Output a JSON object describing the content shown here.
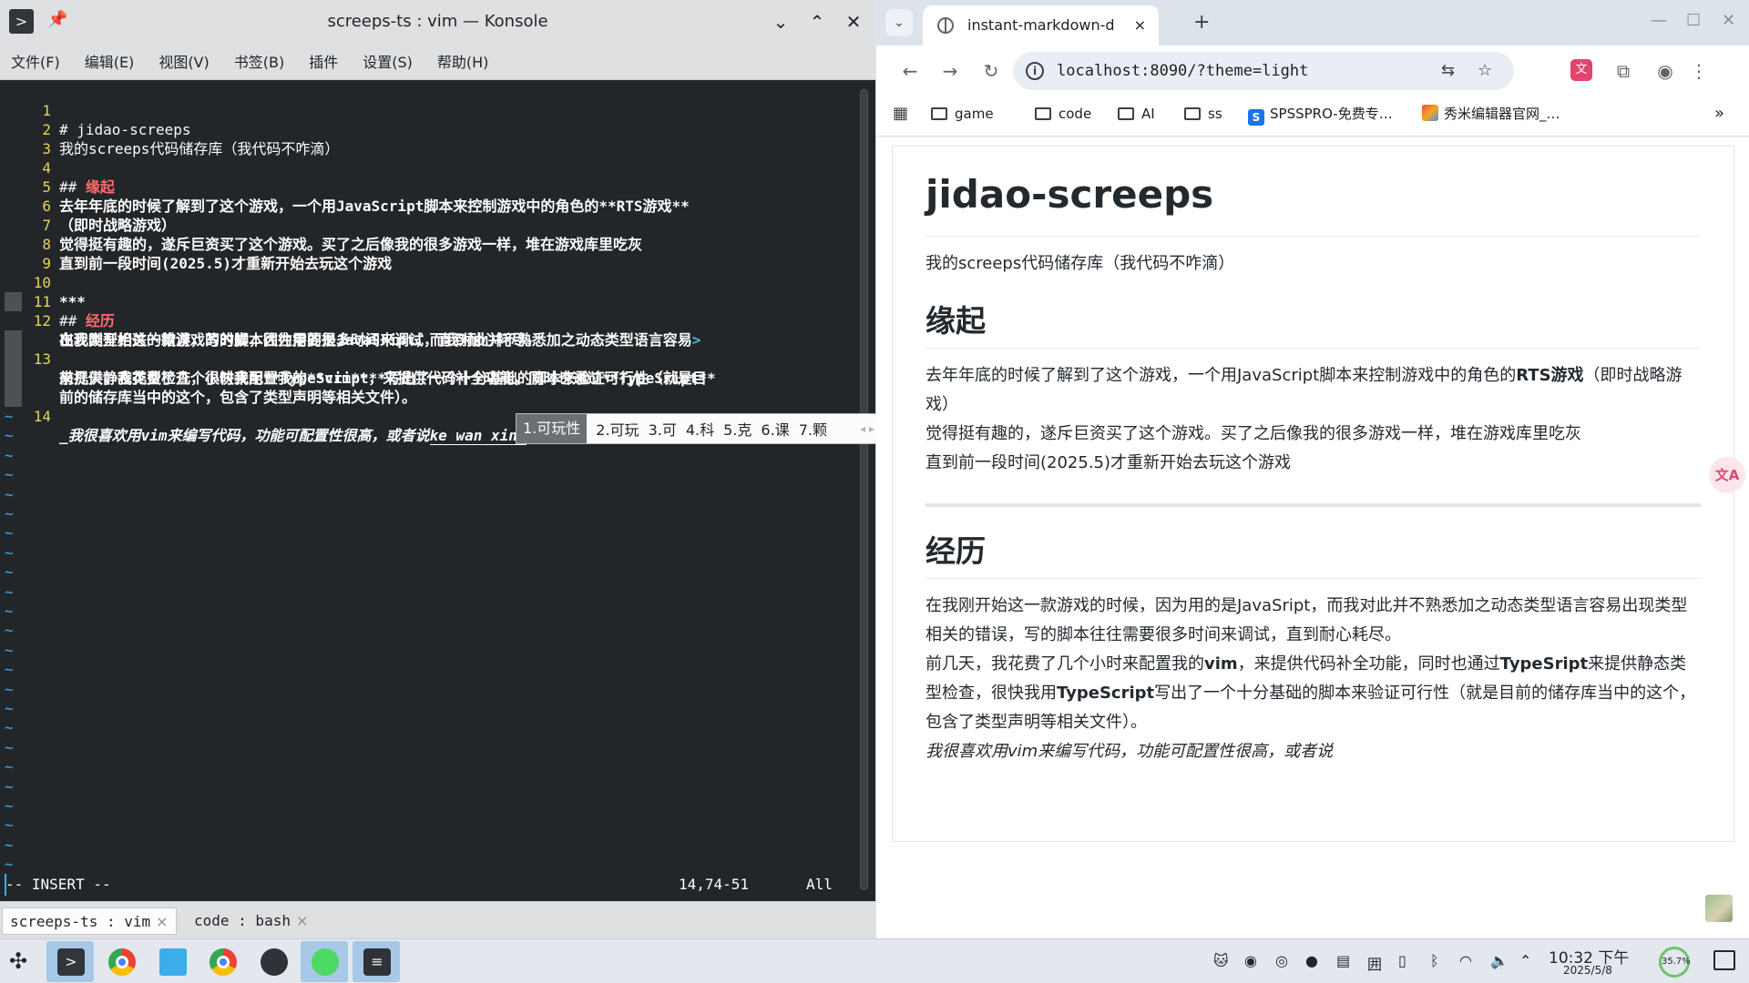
{
  "konsole": {
    "title": "screeps-ts : vim — Konsole",
    "menu": [
      "文件(F)",
      "编辑(E)",
      "视图(V)",
      "书签(B)",
      "插件",
      "设置(S)",
      "帮助(H)"
    ],
    "lines": [
      {
        "n": "1",
        "parts": [
          "# jidao-screeps"
        ]
      },
      {
        "n": "2",
        "parts": [
          "我的screeps代码储存库（我代码不咋滴）"
        ]
      },
      {
        "n": "3",
        "parts": [
          ""
        ]
      },
      {
        "n": "4",
        "parts": [
          "## ",
          "缘起"
        ]
      },
      {
        "n": "5",
        "parts": [
          "去年年底的时候了解到了这个游戏，一个用JavaScript脚本来控制游戏中的角色的**RTS游戏**"
        ]
      },
      {
        "n": "6",
        "parts": [
          "（即时战略游戏）"
        ]
      },
      {
        "n": "7",
        "parts": [
          "觉得挺有趣的，遂斥巨资买了这个游戏。买了之后像我的很多游戏一样，堆在游戏库里吃灰"
        ]
      },
      {
        "n": "8",
        "parts": [
          "直到前一段时间(2025.5)才重新开始去玩这个游戏"
        ]
      },
      {
        "n": "9",
        "parts": [
          ""
        ]
      },
      {
        "n": "10",
        "parts": [
          "***"
        ]
      },
      {
        "n": "11",
        "parts": [
          "## ",
          "经历"
        ]
      },
      {
        "n": "12",
        "parts": [
          "在我刚开始这一款游戏的时候，因为用的是JavaSript，而我对此并不熟悉加之动态类型语言容易",
          ">"
        ]
      },
      {
        "n": "",
        "parts": [
          "出现类型相关的错误，写的脚本往往需要很多时间来调试，直到耐心耗尽。"
        ]
      },
      {
        "n": "13",
        "parts": [
          "前几天，我花费了几个小时来配置我的**vim**，来提供代码补全功能，同时也通过**TypeSript**"
        ]
      },
      {
        "n": "",
        "parts": [
          "来提供静态类型检查，很快我用**TypeScript**写出了一个十分基础的脚本来验证可行性（就是目"
        ]
      },
      {
        "n": "",
        "parts": [
          "前的储存库当中的这个，包含了类型声明等相关文件）。"
        ]
      },
      {
        "n": "14",
        "parts": [
          "_我很喜欢用vim来编写代码，功能可配置性很高，或者说",
          "ke wan xing"
        ]
      }
    ],
    "tilde": "~",
    "status_mode": "-- INSERT --",
    "status_pos": "14,74-51",
    "status_all": "All",
    "ime": {
      "first": "1.可玩性",
      "candidates": [
        "2.可玩",
        "3.可",
        "4.科",
        "5.克",
        "6.课",
        "7.颗"
      ]
    },
    "tabs": [
      {
        "label": "screeps-ts : vim",
        "close": "×"
      },
      {
        "label": "code : bash",
        "close": "×"
      }
    ]
  },
  "chrome": {
    "tab_title": "instant-markdown-d",
    "tab_close": "×",
    "new_tab": "+",
    "url": "localhost:8090/?theme=light",
    "bookmarks": [
      "game",
      "code",
      "AI",
      "ss",
      "SPSSPRO-免费专…",
      "秀米编辑器官网_…"
    ],
    "more": "»",
    "doc": {
      "h1": "jidao-screeps",
      "intro": "我的screeps代码储存库（我代码不咋滴）",
      "h2_origin": "缘起",
      "origin_a": "去年年底的时候了解到了这个游戏，一个用JavaScript脚本来控制游戏中的角色的",
      "origin_bold": "RTS游戏",
      "origin_b": "（即时战略游戏）",
      "origin_2": "觉得挺有趣的，遂斥巨资买了这个游戏。买了之后像我的很多游戏一样，堆在游戏库里吃灰",
      "origin_3": "直到前一段时间(2025.5)才重新开始去玩这个游戏",
      "h2_exp": "经历",
      "exp_1": "在我刚开始这一款游戏的时候，因为用的是JavaSript，而我对此并不熟悉加之动态类型语言容易出现类型相关的错误，写的脚本往往需要很多时间来调试，直到耐心耗尽。",
      "exp_2a": "前几天，我花费了几个小时来配置我的",
      "exp_2_vim": "vim",
      "exp_2b": "，来提供代码补全功能，同时也通过",
      "exp_2_ts1": "TypeSript",
      "exp_2c": "来提供静态类型检查，很快我用",
      "exp_2_ts2": "TypeScript",
      "exp_2d": "写出了一个十分基础的脚本来验证可行性（就是目前的储存库当中的这个，包含了类型声明等相关文件）。",
      "exp_3": "我很喜欢用vim来编写代码，功能可配置性很高，或者说"
    },
    "side_badge": "文A"
  },
  "taskbar": {
    "clock_time": "10:32 下午",
    "clock_date": "2025/5/8",
    "battery": "35.7%"
  },
  "colors": {
    "terminal_bg": "#232629",
    "line_number": "#e5d559",
    "heading_red": "#ff6b6b",
    "tilde_blue": "#3daee9"
  }
}
